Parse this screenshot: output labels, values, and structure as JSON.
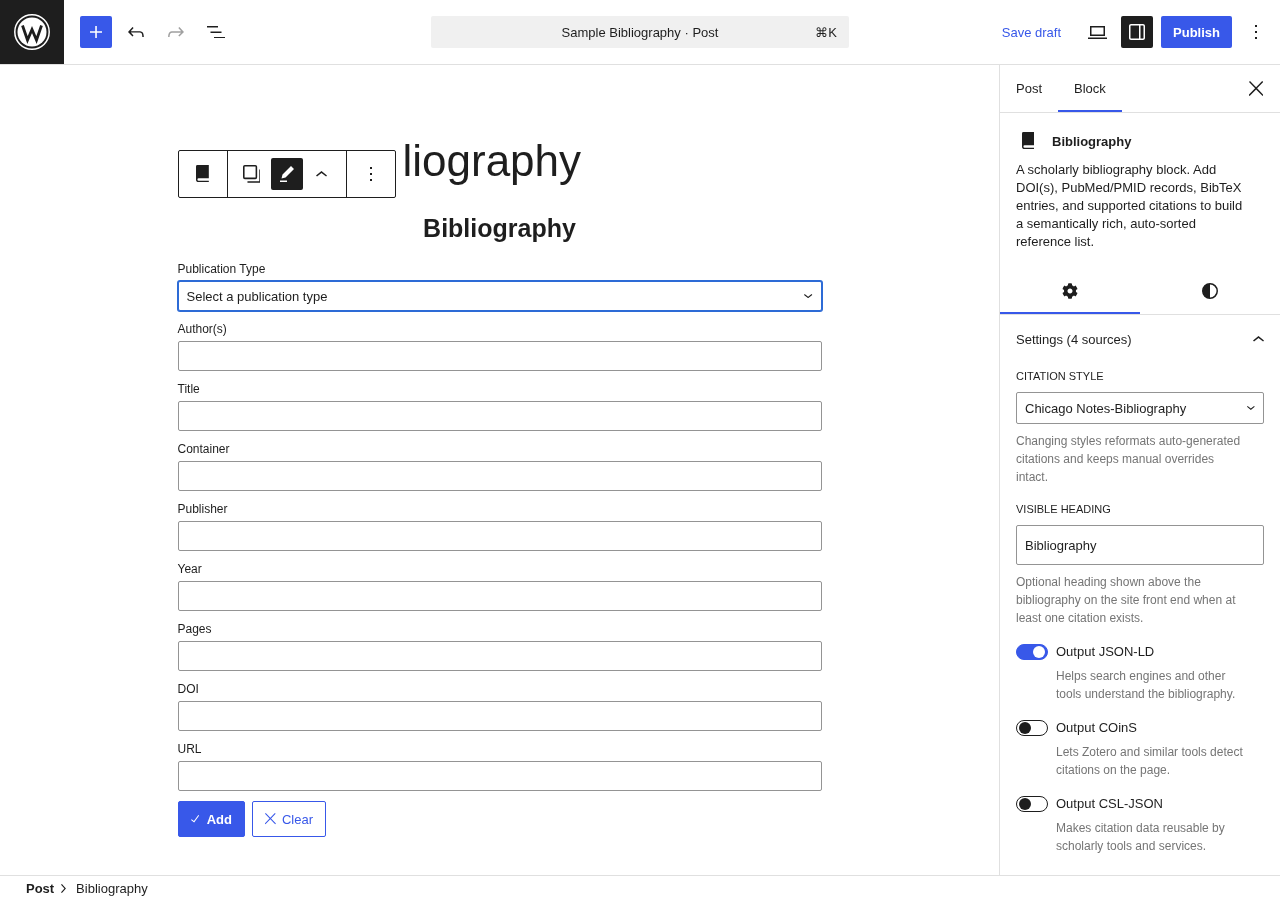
{
  "top_bar": {
    "document_title": "Sample Bibliography · Post",
    "shortcut": "⌘K",
    "undo_disabled": false,
    "redo_disabled": true,
    "save_draft": "Save draft",
    "settings_pressed": true,
    "publish": "Publish"
  },
  "editor": {
    "post_title": "liography",
    "block_toolbar": {
      "edit_pressed": true
    },
    "heading": "Bibliography",
    "fields": [
      {
        "kind": "select",
        "label": "Publication Type",
        "value": "Select a publication type",
        "focused": true
      },
      {
        "kind": "text",
        "label": "Author(s)",
        "focused": false
      },
      {
        "kind": "text",
        "label": "Title",
        "focused": false
      },
      {
        "kind": "text",
        "label": "Container",
        "focused": false
      },
      {
        "kind": "text",
        "label": "Publisher",
        "focused": false
      },
      {
        "kind": "text",
        "label": "Year",
        "focused": false
      },
      {
        "kind": "text",
        "label": "Pages",
        "focused": false
      },
      {
        "kind": "text",
        "label": "DOI",
        "focused": false
      },
      {
        "kind": "text",
        "label": "URL",
        "focused": false
      }
    ],
    "buttons": [
      {
        "kind": "primary",
        "label": "Add"
      },
      {
        "kind": "secondary",
        "label": "Clear"
      }
    ]
  },
  "sidebar": {
    "tabs": [
      {
        "label": "Post",
        "selected": false
      },
      {
        "label": "Block",
        "selected": true
      }
    ],
    "block": {
      "title": "Bibliography",
      "description": "A scholarly bibliography block. Add DOI(s), PubMed/PMID records, BibTeX entries, and supported citations to build a semantically rich, auto-sorted reference list."
    },
    "subtabs": [
      {
        "kind": "settings",
        "selected": true
      },
      {
        "kind": "styles",
        "selected": false
      }
    ],
    "panel": {
      "title": "Settings (4 sources)",
      "expanded": true,
      "controls": [
        {
          "kind": "select",
          "label": "CITATION STYLE",
          "value": "Chicago Notes-Bibliography",
          "help": "Changing styles reformats auto-generated citations and keeps manual overrides intact."
        },
        {
          "kind": "text",
          "label": "VISIBLE HEADING",
          "value": "Bibliography",
          "help": "Optional heading shown above the bibliography on the site front end when at least one citation exists."
        },
        {
          "kind": "toggle",
          "label": "Output JSON-LD",
          "on": true,
          "help": "Helps search engines and other tools understand the bibliography."
        },
        {
          "kind": "toggle",
          "label": "Output COinS",
          "on": false,
          "help": "Lets Zotero and similar tools detect citations on the page."
        },
        {
          "kind": "toggle",
          "label": "Output CSL-JSON",
          "on": false,
          "help": "Makes citation data reusable by scholarly tools and services."
        }
      ]
    }
  },
  "breadcrumb": [
    {
      "label": "Post"
    },
    {
      "label": "Bibliography"
    }
  ]
}
